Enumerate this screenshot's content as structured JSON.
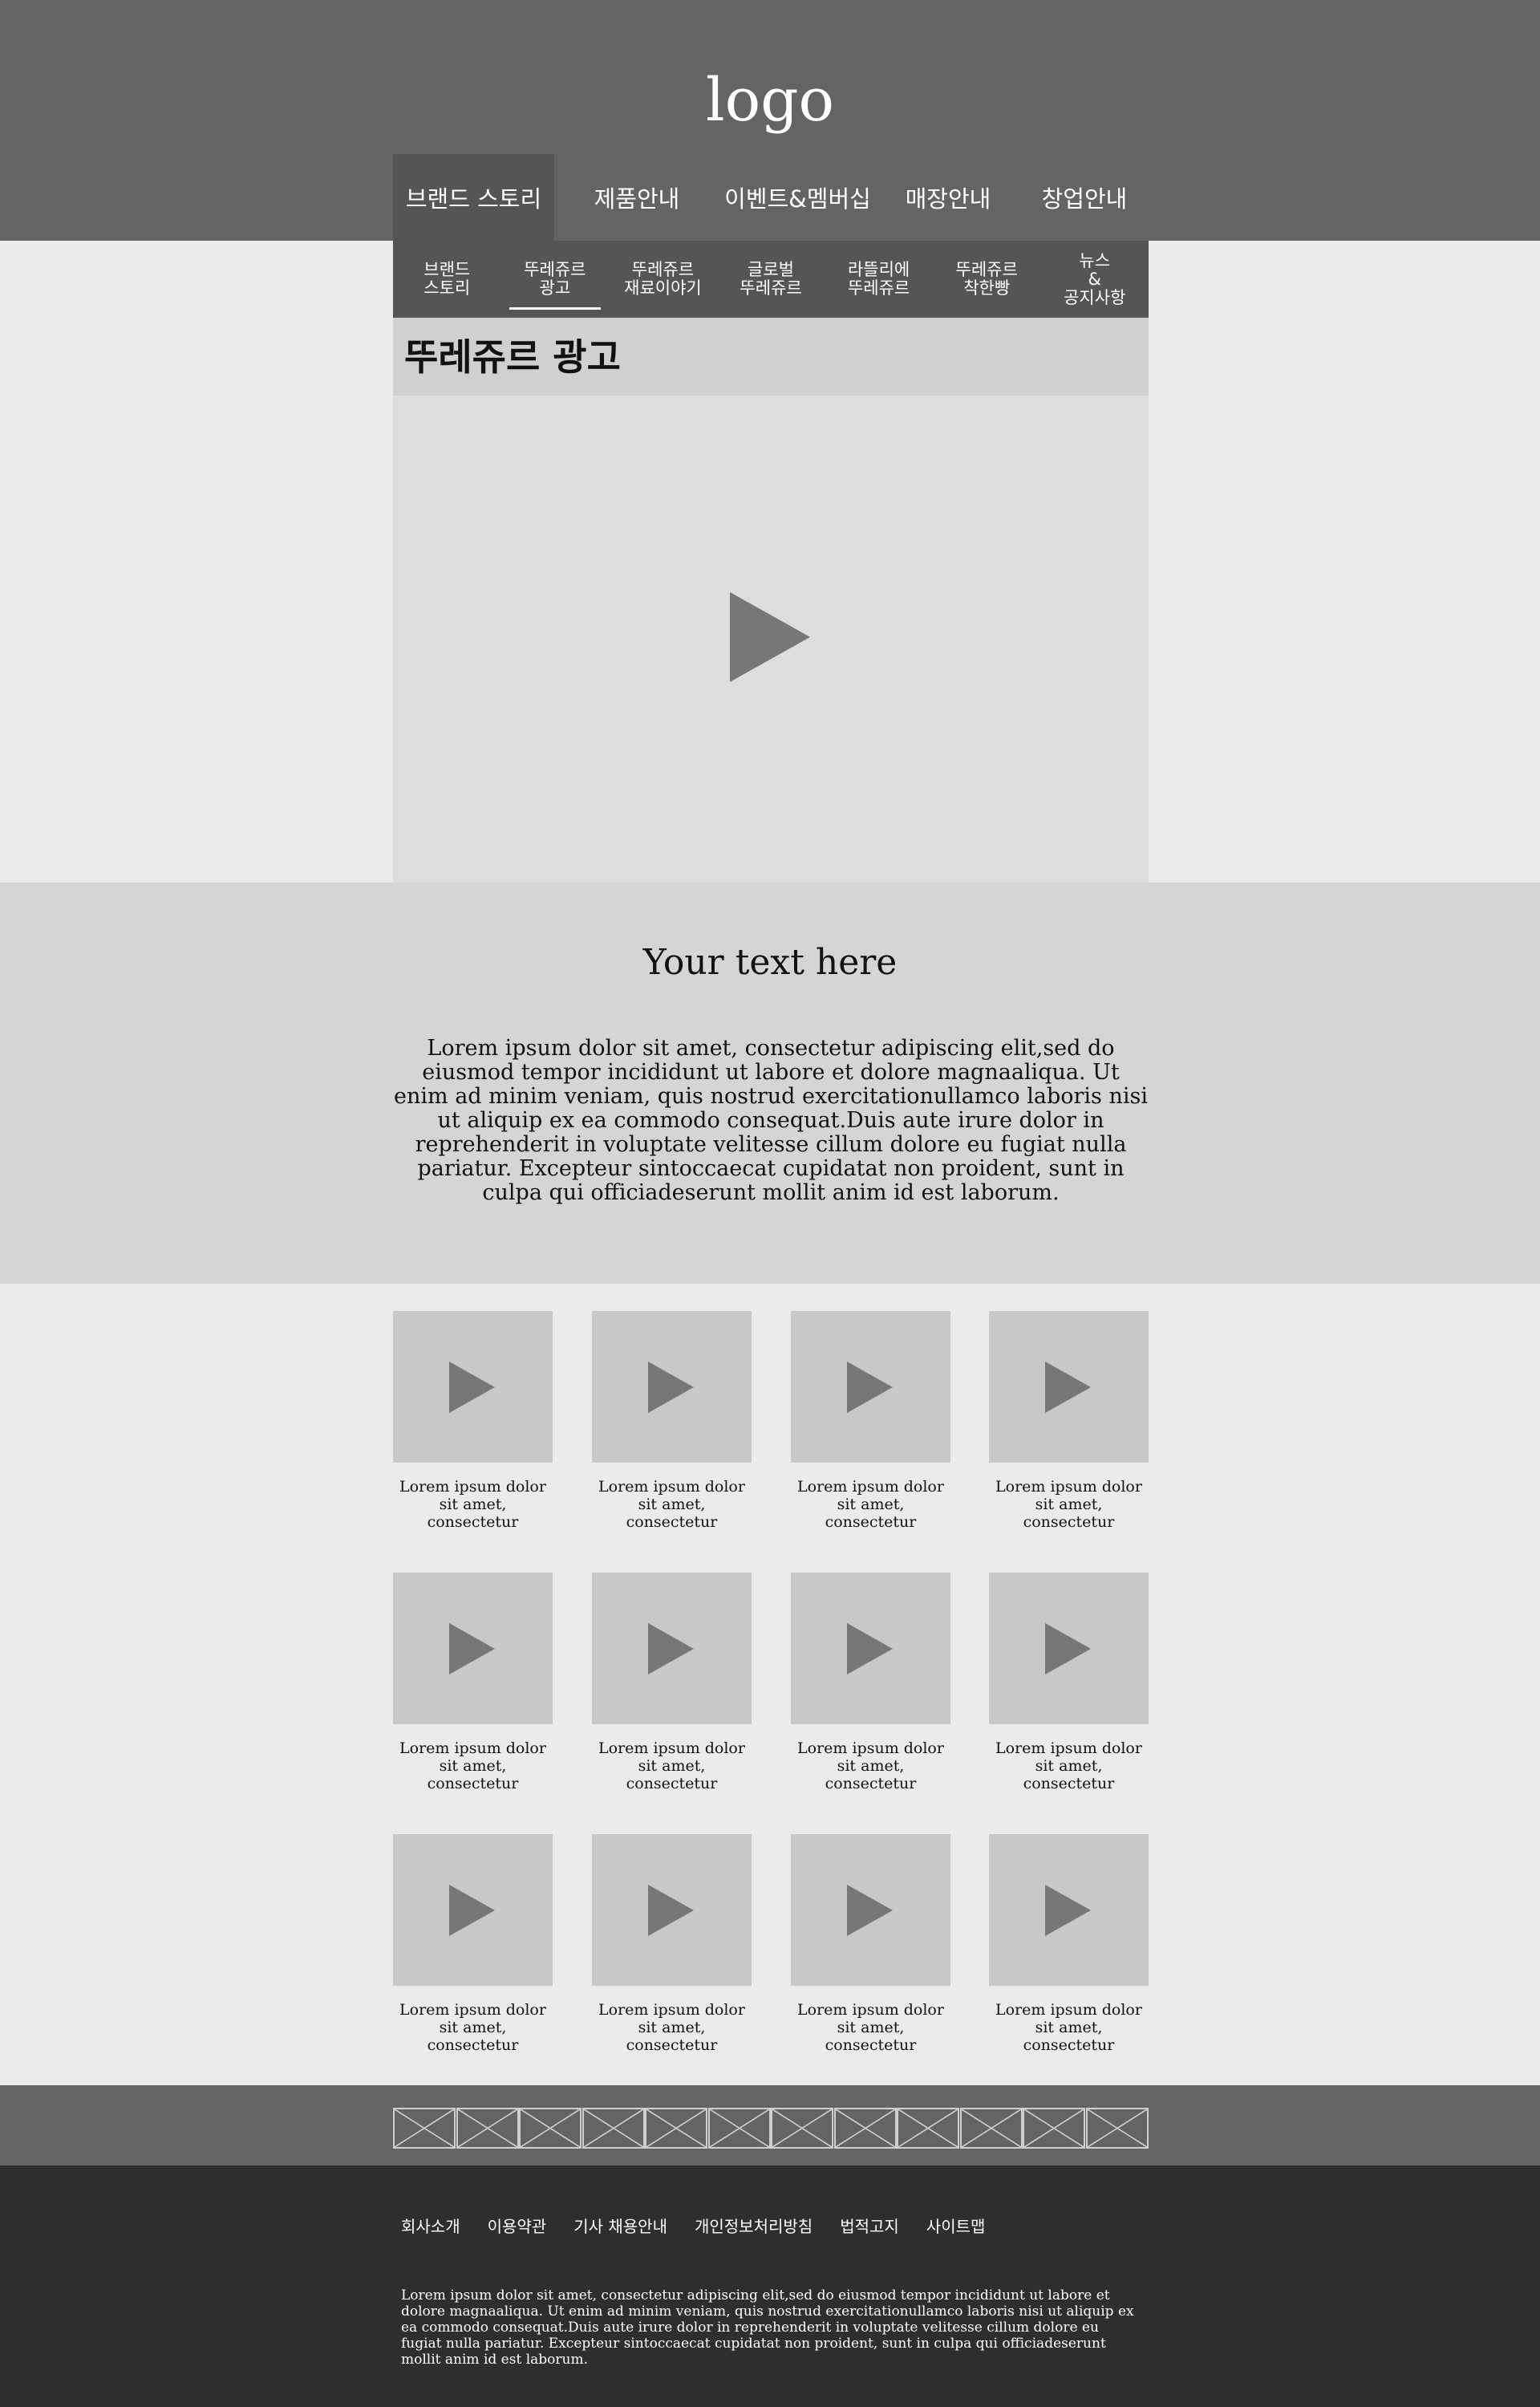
{
  "header": {
    "logo": "logo",
    "nav": [
      "브랜드 스토리",
      "제품안내",
      "이벤트&멤버십",
      "매장안내",
      "창업안내"
    ],
    "nav_active": 0
  },
  "sub_nav": {
    "items": [
      "브랜드\n스토리",
      "뚜레쥬르\n광고",
      "뚜레쥬르\n재료이야기",
      "글로벌\n뚜레쥬르",
      "라뜰리에\n뚜레쥬르",
      "뚜레쥬르\n착한빵",
      "뉴스\n&\n공지사항"
    ],
    "active": 1
  },
  "page_title": "뚜레쥬르 광고",
  "main_video": {
    "icon": "play-icon"
  },
  "text_band": {
    "heading": "Your text here",
    "body": "Lorem ipsum dolor sit amet, consectetur adipiscing elit,sed do eiusmod tempor incididunt ut labore et dolore magnaaliqua. Ut enim ad minim veniam, quis nostrud exercitationullamco laboris nisi ut aliquip ex ea commodo consequat.Duis aute irure dolor in reprehenderit in voluptate velitesse cillum dolore eu fugiat nulla pariatur. Excepteur sintoccaecat cupidatat non proident, sunt in culpa qui officiadeserunt mollit anim id est laborum."
  },
  "video_grid": [
    {
      "caption": "Lorem ipsum dolor sit amet, consectetur adipiscing elit,sed"
    },
    {
      "caption": "Lorem ipsum dolor sit amet, consectetur adipiscing elit,sed"
    },
    {
      "caption": "Lorem ipsum dolor sit amet, consectetur adipiscing elit,sed"
    },
    {
      "caption": "Lorem ipsum dolor sit amet, consectetur adipiscing elit,sed"
    },
    {
      "caption": "Lorem ipsum dolor sit amet, consectetur adipiscing elit,sed"
    },
    {
      "caption": "Lorem ipsum dolor sit amet, consectetur adipiscing elit,sed"
    },
    {
      "caption": "Lorem ipsum dolor sit amet, consectetur adipiscing elit,sed"
    },
    {
      "caption": "Lorem ipsum dolor sit amet, consectetur adipiscing elit,sed"
    },
    {
      "caption": "Lorem ipsum dolor sit amet, consectetur adipiscing elit,sed"
    },
    {
      "caption": "Lorem ipsum dolor sit amet, consectetur adipiscing elit,sed"
    },
    {
      "caption": "Lorem ipsum dolor sit amet, consectetur adipiscing elit,sed"
    },
    {
      "caption": "Lorem ipsum dolor sit amet, consectetur adipiscing elit,sed"
    }
  ],
  "partners": {
    "count": 12,
    "icon": "image-placeholder-icon"
  },
  "footer": {
    "links": [
      "회사소개",
      "이용약관",
      "기사 채용안내",
      "개인정보처리방침",
      "법적고지",
      "사이트맵"
    ],
    "text": "Lorem ipsum dolor sit amet, consectetur adipiscing elit,sed do eiusmod tempor incididunt ut labore et dolore magnaaliqua. Ut enim ad minim veniam, quis nostrud exercitationullamco laboris nisi ut aliquip ex ea commodo consequat.Duis aute irure dolor in reprehenderit in voluptate velitesse cillum dolore eu fugiat nulla pariatur. Excepteur sintoccaecat cupidatat non proident, sunt in culpa qui officiadeserunt mollit anim id est laborum."
  },
  "colors": {
    "header_bg": "#646464",
    "subnav_bg": "#555555",
    "footer_bg": "#2e2e2e",
    "page_bg": "#ebebeb",
    "band_bg": "#d5d5d5",
    "play_icon": "#777777"
  }
}
